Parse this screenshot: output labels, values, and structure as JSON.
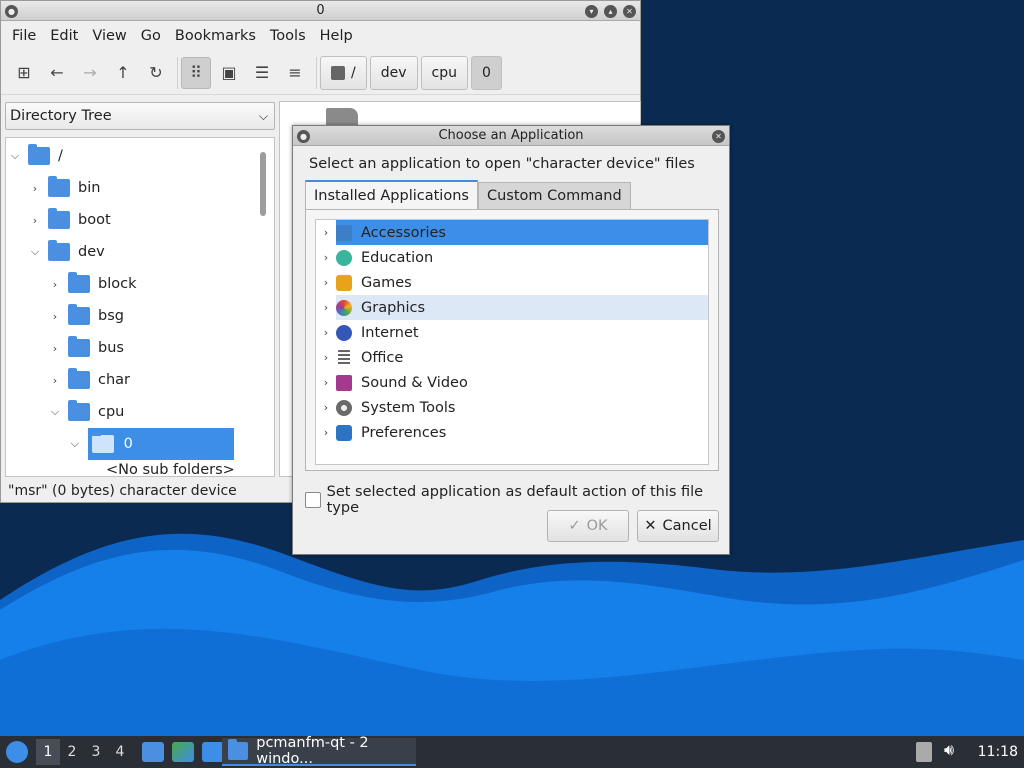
{
  "fm": {
    "title": "0",
    "menus": [
      "File",
      "Edit",
      "View",
      "Go",
      "Bookmarks",
      "Tools",
      "Help"
    ],
    "breadcrumb": [
      "/",
      "dev",
      "cpu",
      "0"
    ],
    "dir_selector": "Directory Tree",
    "tree": [
      {
        "label": "/",
        "expanded": true
      },
      {
        "label": "bin",
        "expanded": false
      },
      {
        "label": "boot",
        "expanded": false
      },
      {
        "label": "dev",
        "expanded": true
      },
      {
        "label": "block",
        "expanded": false
      },
      {
        "label": "bsg",
        "expanded": false
      },
      {
        "label": "bus",
        "expanded": false
      },
      {
        "label": "char",
        "expanded": false
      },
      {
        "label": "cpu",
        "expanded": true
      },
      {
        "label": "0",
        "expanded": true,
        "selected": true
      }
    ],
    "no_sub_folders": "<No sub folders>",
    "status": "\"msr\" (0 bytes) character device"
  },
  "dialog": {
    "title": "Choose an Application",
    "prompt": "Select an application to open \"character device\" files",
    "tabs": [
      "Installed Applications",
      "Custom Command"
    ],
    "categories": [
      {
        "label": "Accessories",
        "icon": "accessories-icon",
        "color": "#3d7ec8",
        "state": "selected"
      },
      {
        "label": "Education",
        "icon": "education-icon",
        "color": "#39b59b",
        "state": ""
      },
      {
        "label": "Games",
        "icon": "games-icon",
        "color": "#e8a21b",
        "state": ""
      },
      {
        "label": "Graphics",
        "icon": "graphics-icon",
        "color": "#e0453a",
        "state": "hover"
      },
      {
        "label": "Internet",
        "icon": "internet-icon",
        "color": "#3557b8",
        "state": ""
      },
      {
        "label": "Office",
        "icon": "office-icon",
        "color": "#666666",
        "state": ""
      },
      {
        "label": "Sound & Video",
        "icon": "sound-video-icon",
        "color": "#a33a8f",
        "state": ""
      },
      {
        "label": "System Tools",
        "icon": "system-tools-icon",
        "color": "#6a6a6a",
        "state": ""
      },
      {
        "label": "Preferences",
        "icon": "preferences-icon",
        "color": "#2f73c4",
        "state": ""
      }
    ],
    "default_checkbox": "Set selected application as default action of this file type",
    "ok": "OK",
    "cancel": "Cancel"
  },
  "taskbar": {
    "workspaces": [
      "1",
      "2",
      "3",
      "4"
    ],
    "task": "pcmanfm-qt - 2 windo...",
    "clock": "11:18"
  }
}
